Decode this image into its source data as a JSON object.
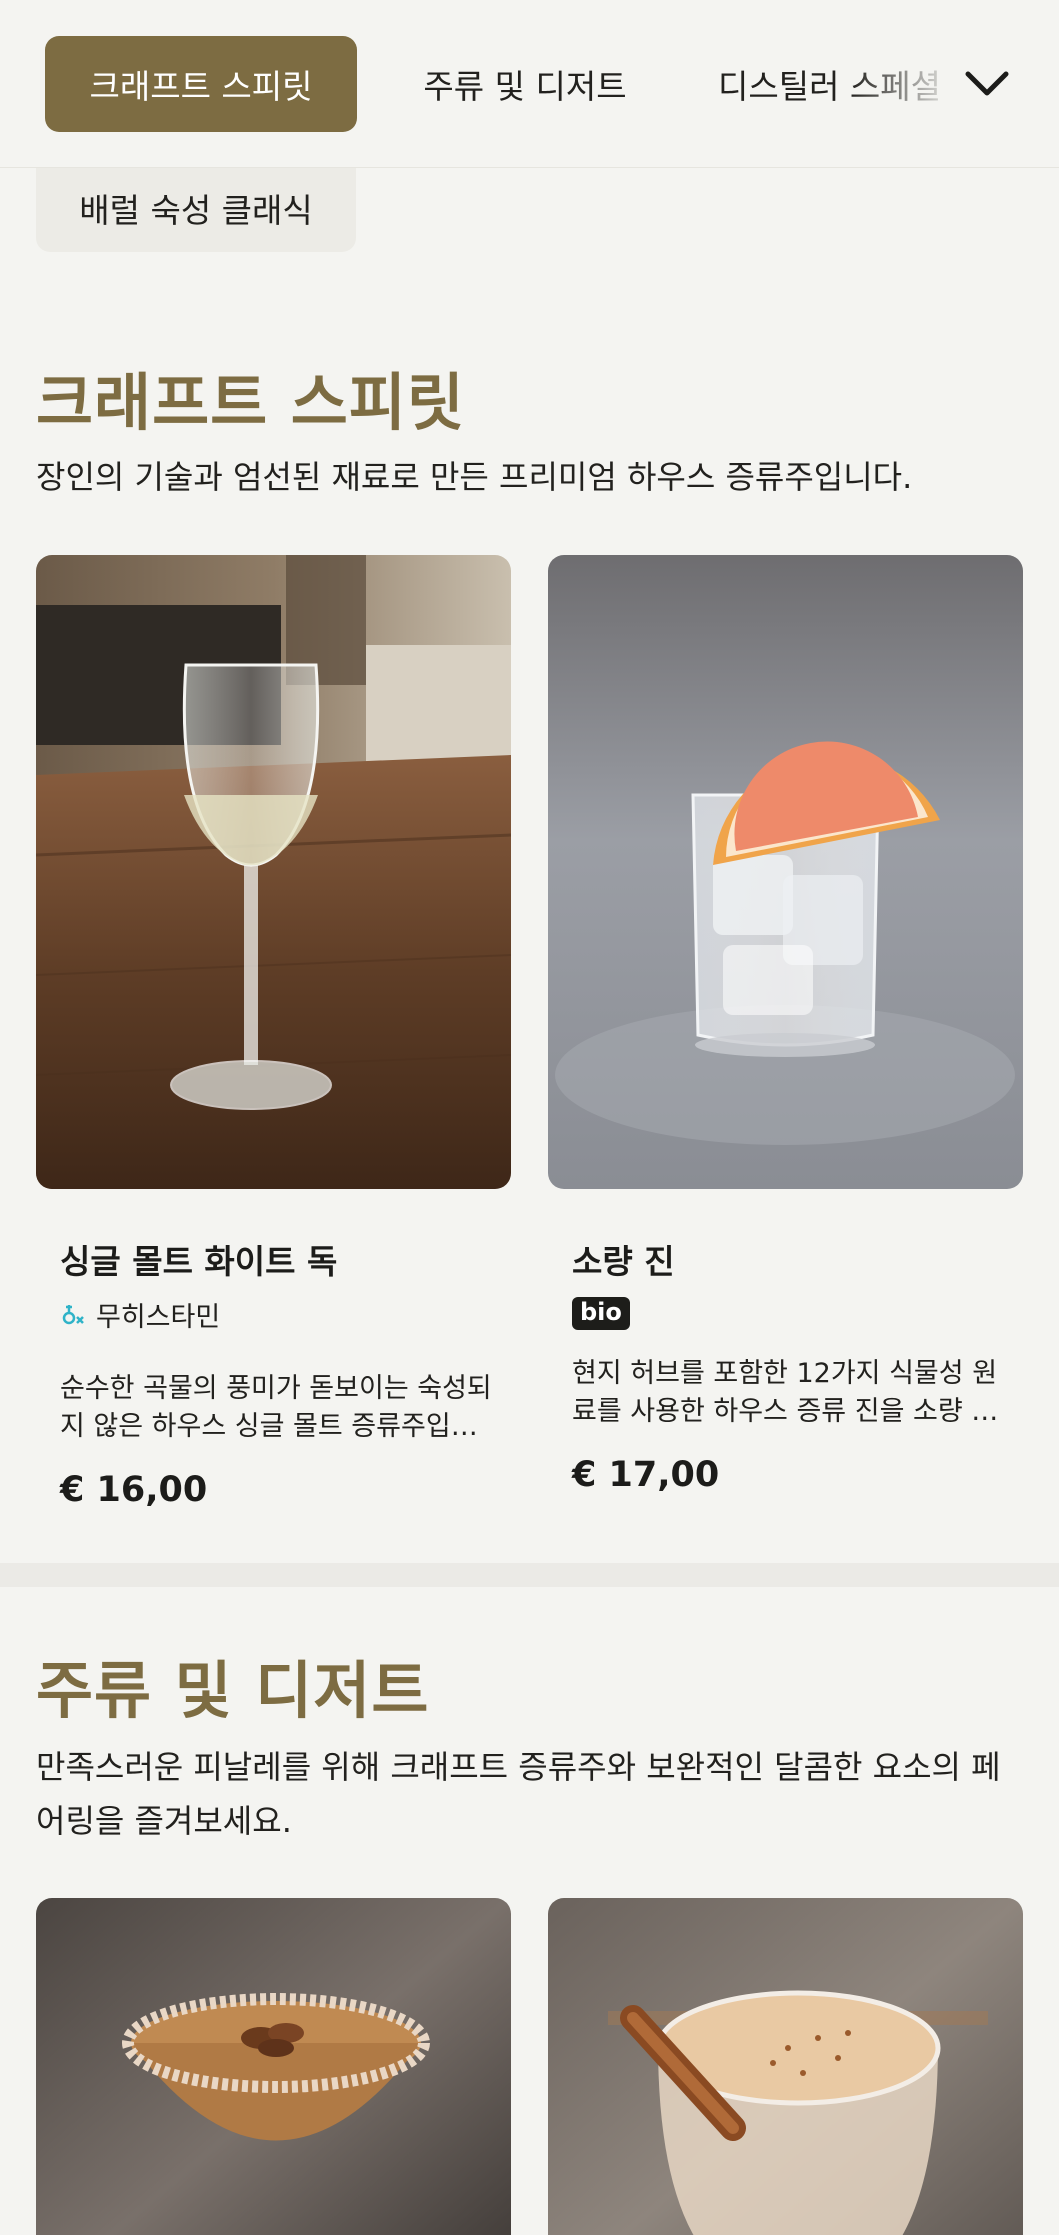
{
  "nav": {
    "tabs": [
      {
        "label": "크래프트 스피릿",
        "active": true
      },
      {
        "label": "주류 및 디저트",
        "active": false
      },
      {
        "label": "디스틸러 스페셜",
        "active": false
      }
    ],
    "subtabs": [
      {
        "label": "배럴 숙성 클래식"
      }
    ],
    "expand_icon": "chevron-down-icon"
  },
  "sections": [
    {
      "title": "크래프트 스피릿",
      "description": "장인의 기술과 엄선된 재료로 만든 프리미엄 하우스 증류주입니다.",
      "products": [
        {
          "name": "싱글 몰트 화이트 독",
          "tag": "무히스타민",
          "tag_icon": "histamine-free-icon",
          "description": "순수한 곡물의 풍미가 돋보이는 숙성되지 않은 하우스 싱글 몰트 증류주입니다.",
          "price": "€ 16,00",
          "image": "wine-glass-photo"
        },
        {
          "name": "소량 진",
          "tag": "bio",
          "description": "현지 허브를 포함한 12가지 식물성 원료를 사용한 하우스 증류 진을 소량 생산합니다.",
          "price": "€ 17,00",
          "image": "gin-with-grapefruit-photo"
        }
      ]
    },
    {
      "title": "주류 및 디저트",
      "description": "만족스러운 피날레를 위해 크래프트 증류주와 보완적인 달콤한 요소의 페어링을 즐겨보세요.",
      "products": [
        {
          "image": "pecan-martini-photo"
        },
        {
          "image": "cinnamon-eggnog-photo"
        }
      ]
    }
  ],
  "colors": {
    "accent": "#7d6c42",
    "background": "#f4f4f1",
    "text": "#1c1c1a"
  }
}
